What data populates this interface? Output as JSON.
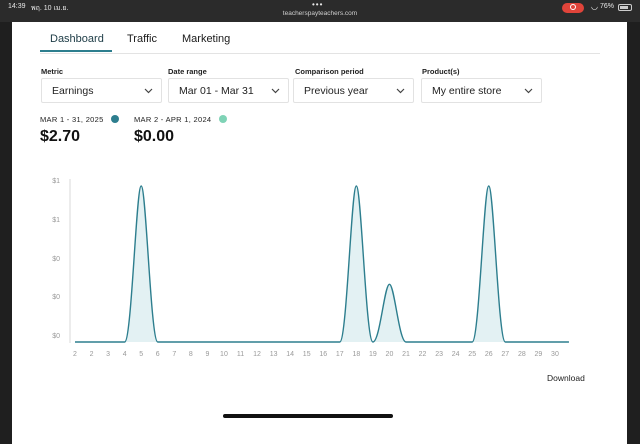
{
  "status_bar": {
    "time": "14:39",
    "date": "พฤ. 10 เม.ย.",
    "dots": "•••",
    "url": "teacherspayteachers.com",
    "battery": "76%"
  },
  "tabs": [
    {
      "label": "Dashboard",
      "active": true
    },
    {
      "label": "Traffic",
      "active": false
    },
    {
      "label": "Marketing",
      "active": false
    }
  ],
  "filters": {
    "metric": {
      "label": "Metric",
      "value": "Earnings"
    },
    "date_range": {
      "label": "Date range",
      "value": "Mar 01 - Mar 31"
    },
    "comparison": {
      "label": "Comparison period",
      "value": "Previous year"
    },
    "products": {
      "label": "Product(s)",
      "value": "My entire store"
    }
  },
  "summary": {
    "current": {
      "label": "MAR 1 - 31, 2025",
      "value": "$2.70",
      "color": "#2d7e8e"
    },
    "previous": {
      "label": "MAR 2 - APR 1, 2024",
      "value": "$0.00",
      "color": "#7fd3b6"
    }
  },
  "chart_data": {
    "type": "area",
    "x_tick_labels": [
      "2",
      "2",
      "3",
      "4",
      "5",
      "6",
      "7",
      "8",
      "9",
      "10",
      "11",
      "12",
      "13",
      "14",
      "15",
      "16",
      "17",
      "18",
      "19",
      "20",
      "21",
      "22",
      "23",
      "24",
      "25",
      "26",
      "27",
      "28",
      "29",
      "30"
    ],
    "y_tick_labels": [
      "$1",
      "$1",
      "$0",
      "$0",
      "$0"
    ],
    "series": [
      {
        "color": "#2d7e8e",
        "values": [
          0,
          0,
          0,
          0,
          1,
          0,
          0,
          0,
          0,
          0,
          0,
          0,
          0,
          0,
          0,
          0,
          0,
          1,
          0,
          0.37,
          0,
          0,
          0,
          0,
          0,
          1,
          0,
          0,
          0,
          0
        ]
      }
    ],
    "grid": false
  },
  "download_label": "Download",
  "colors": {
    "accent": "#2d7e8e",
    "fill": "#e3f1f3"
  }
}
